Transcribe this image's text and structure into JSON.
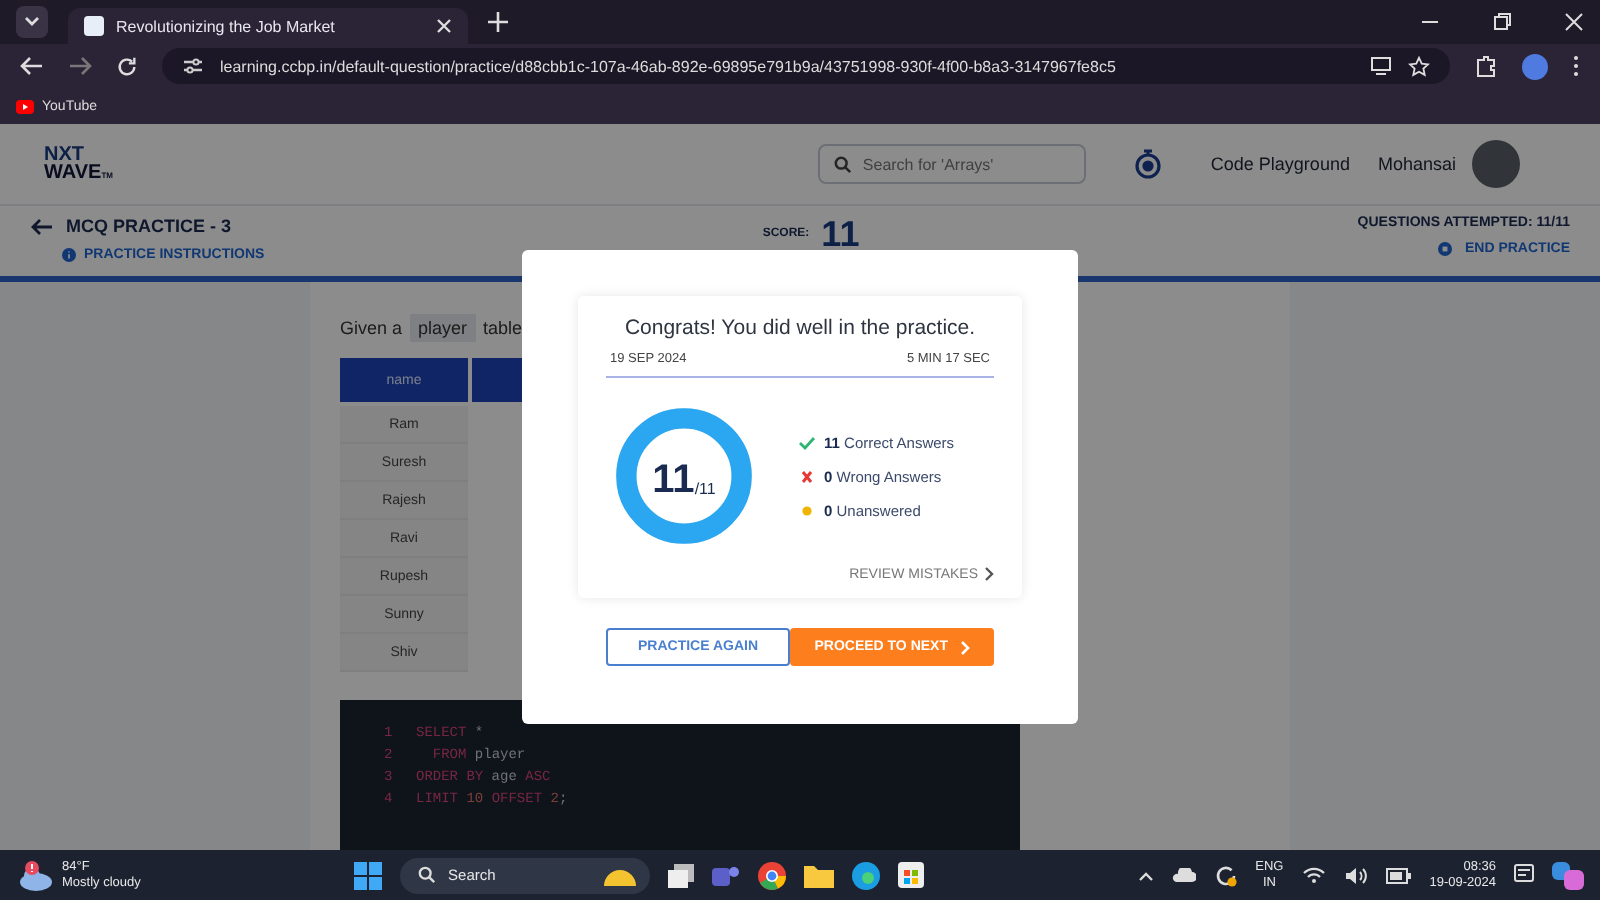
{
  "browser": {
    "tab_title": "Revolutionizing the Job Market",
    "url": "learning.ccbp.in/default-question/practice/d88cbb1c-107a-46ab-892e-69895e791b9a/43751998-930f-4f00-b8a3-3147967fe8c5",
    "bookmark": "YouTube"
  },
  "header": {
    "logo_top": "NXT",
    "logo_bottom": "WAVE",
    "logo_mark": "TM",
    "search": {
      "placeholder": "Search for 'Arrays'"
    },
    "nav_link": "Code Playground",
    "user": "Mohansai"
  },
  "subheader": {
    "title": "MCQ PRACTICE - 3",
    "instructions": "PRACTICE INSTRUCTIONS",
    "score_label": "SCORE:",
    "score": "11",
    "attempted": "QUESTIONS ATTEMPTED: 11/11",
    "end": "END PRACTICE"
  },
  "question": {
    "prefix": "Given a",
    "code": "player",
    "suffix": "table"
  },
  "table": {
    "columns": [
      "name"
    ],
    "rows": [
      "Ram",
      "Suresh",
      "Rajesh",
      "Ravi",
      "Rupesh",
      "Sunny",
      "Shiv"
    ]
  },
  "code": [
    {
      "num": "1",
      "tokens": [
        {
          "kind": "keyword",
          "text": "SELECT"
        },
        {
          "kind": "plain",
          "text": " *"
        }
      ]
    },
    {
      "num": "2",
      "tokens": [
        {
          "kind": "keyword",
          "text": "  FROM"
        },
        {
          "kind": "plain",
          "text": " player"
        }
      ]
    },
    {
      "num": "3",
      "tokens": [
        {
          "kind": "keyword",
          "text": "ORDER BY"
        },
        {
          "kind": "plain",
          "text": " age "
        },
        {
          "kind": "keyword",
          "text": "ASC"
        }
      ]
    },
    {
      "num": "4",
      "tokens": [
        {
          "kind": "keyword",
          "text": "LIMIT"
        },
        {
          "kind": "number",
          "text": " 10 "
        },
        {
          "kind": "keyword",
          "text": "OFFSET"
        },
        {
          "kind": "number",
          "text": " 2"
        },
        {
          "kind": "plain",
          "text": ";"
        }
      ]
    }
  ],
  "modal": {
    "message": "Congrats! You did well in the practice.",
    "date": "19 SEP 2024",
    "duration": "5 MIN 17 SEC",
    "score": "11",
    "total": "/11",
    "level": 1,
    "stats": [
      {
        "kind": "correct",
        "count": "11",
        "label": "Correct Answers"
      },
      {
        "kind": "wrong",
        "count": "0",
        "label": "Wrong Answers"
      },
      {
        "kind": "unanswered",
        "count": "0",
        "label": "Unanswered"
      }
    ],
    "review": "REVIEW MISTAKES",
    "buttons": [
      {
        "kind": "outline",
        "label": "PRACTICE AGAIN"
      },
      {
        "kind": "primary",
        "label": "PROCEED TO NEXT"
      }
    ]
  },
  "taskbar": {
    "temperature": "84°F",
    "weather": "Mostly cloudy",
    "search": "Search",
    "lang_top": "ENG",
    "lang_bottom": "IN",
    "time": "08:36",
    "date": "19-09-2024"
  }
}
